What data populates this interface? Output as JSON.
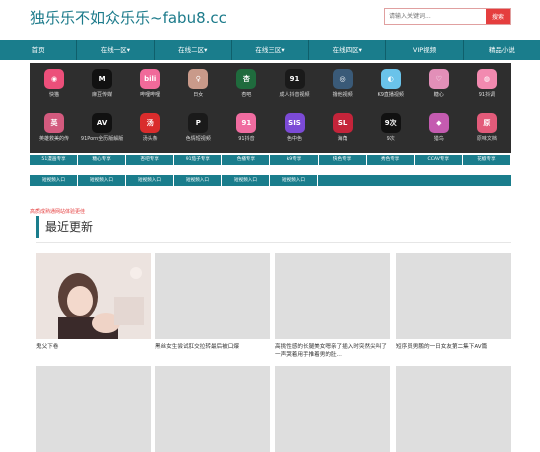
{
  "header": {
    "logo": "独乐乐不如众乐乐~fabu8.cc",
    "search_placeholder": "请输入关键词...",
    "search_button": "搜索"
  },
  "nav": [
    "首页",
    "在线一区▾",
    "在线二区▾",
    "在线三区▾",
    "在线四区▾",
    "VIP视频",
    "精品小说"
  ],
  "apps": [
    {
      "label": "快猫",
      "color": "#ec4f7a",
      "glyph": "◉"
    },
    {
      "label": "麻豆传媒",
      "color": "#111111",
      "glyph": "M"
    },
    {
      "label": "哔哩哔哩",
      "color": "#f06a9a",
      "glyph": "bili"
    },
    {
      "label": "日女",
      "color": "#c99a8a",
      "glyph": "♀"
    },
    {
      "label": "杏吧",
      "color": "#1f6b3d",
      "glyph": "杏"
    },
    {
      "label": "成人抖音视频",
      "color": "#1a1a1a",
      "glyph": "91"
    },
    {
      "label": "撸他视频",
      "color": "#3a5a78",
      "glyph": "◎"
    },
    {
      "label": "K9直播视频",
      "color": "#6ac3ea",
      "glyph": "◐"
    },
    {
      "label": "糖心",
      "color": "#e28fb8",
      "glyph": "♡"
    },
    {
      "label": "91抖调",
      "color": "#f28ab0",
      "glyph": "◍"
    },
    {
      "label": "英雄救美的传",
      "color": "#d35a7e",
      "glyph": "英"
    },
    {
      "label": "91Porn全历版解版",
      "color": "#111111",
      "glyph": "AV"
    },
    {
      "label": "汤头条",
      "color": "#d92c2c",
      "glyph": "汤"
    },
    {
      "label": "色情短视频",
      "color": "#1a1a1a",
      "glyph": "P"
    },
    {
      "label": "91抖音",
      "color": "#f06ca0",
      "glyph": "91"
    },
    {
      "label": "色中色",
      "color": "#7b4ad6",
      "glyph": "SIS"
    },
    {
      "label": "海角",
      "color": "#c4243a",
      "glyph": "SL"
    },
    {
      "label": "9次",
      "color": "#111111",
      "glyph": "9次"
    },
    {
      "label": "猎鸟",
      "color": "#c45bb0",
      "glyph": "◆"
    },
    {
      "label": "原味文档",
      "color": "#e35b7a",
      "glyph": "原"
    }
  ],
  "links_row1": [
    "51漫画专享",
    "糖心专享",
    "杏吧专享",
    "91茄子专享",
    "色播专享",
    "k9专享",
    "快色专享",
    "秀色专享",
    "CCAV专享",
    "花椒专享"
  ],
  "links_row2": [
    "短视频入口",
    "短视频入口",
    "短视频入口",
    "短视频入口",
    "短视频入口",
    "短视频入口"
  ],
  "notice": "高质成熟通网站体验更佳",
  "section_title": "最近更新",
  "videos": [
    {
      "title": "鬼父下卷"
    },
    {
      "title": "黑丝女生尝试肛交拉转最后被口爆"
    },
    {
      "title": "高挑性感的长腿美女嗯亲了插入时突然尖叫了一声哭着用手推着男的肚..."
    },
    {
      "title": "短序员男鹏的一日女友第二集下AV篇"
    }
  ]
}
